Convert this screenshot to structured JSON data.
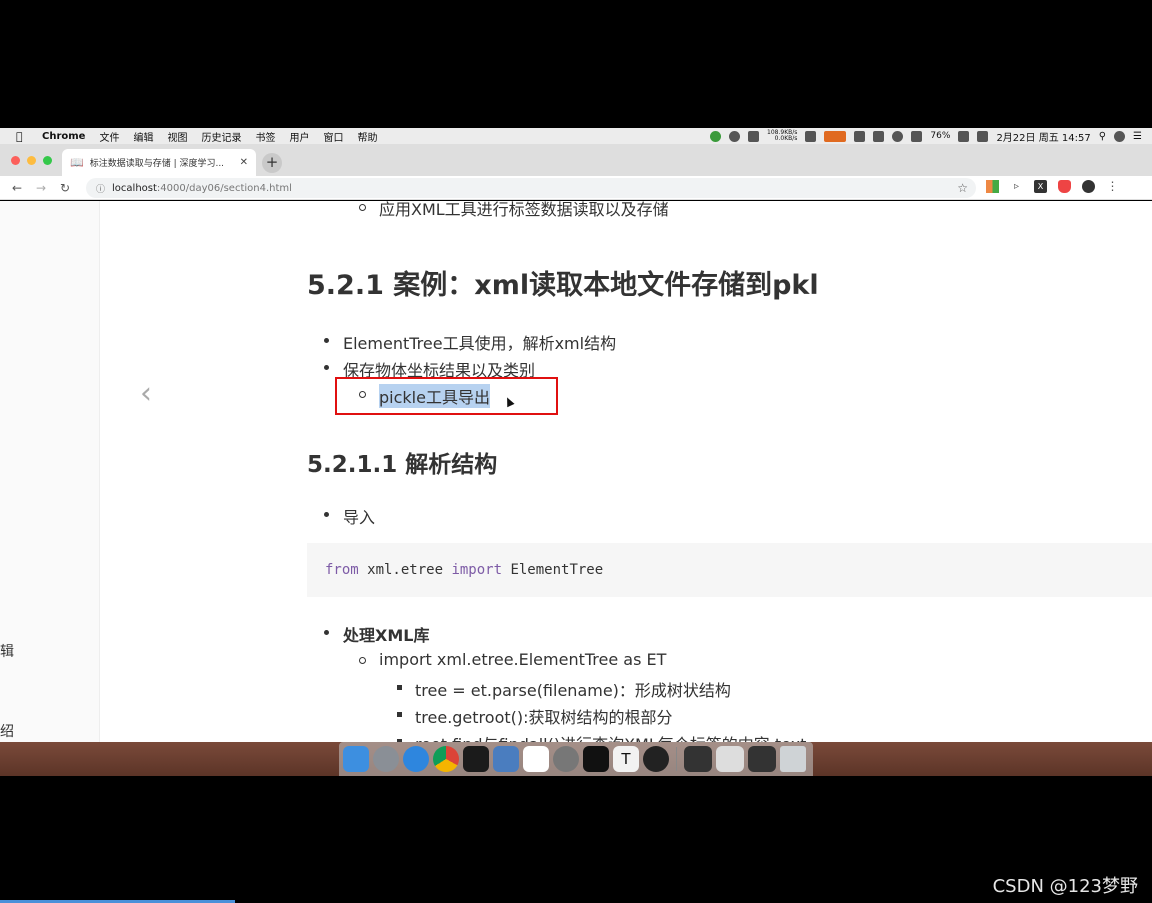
{
  "menubar": {
    "app": "Chrome",
    "items": [
      "文件",
      "编辑",
      "视图",
      "历史记录",
      "书签",
      "用户",
      "窗口",
      "帮助"
    ],
    "net_up": "108.9KB/s",
    "net_down": "0.0KB/s",
    "battery": "76%",
    "datetime": "2月22日 周五  14:57"
  },
  "browser": {
    "tab_title": "标注数据读取与存储 | 深度学习...",
    "url_host": "localhost",
    "url_path": ":4000/day06/section4.html"
  },
  "sidebar": {
    "fragments": [
      "辑",
      "绍"
    ]
  },
  "page": {
    "top_item": "应用XML工具进行标签数据读取以及存储",
    "h1": "5.2.1 案例：xml读取本地文件存储到pkl",
    "bullets1": [
      "ElementTree工具使用，解析xml结构",
      "保存物体坐标结果以及类别"
    ],
    "sub_highlight": "pickle工具导出",
    "h2": "5.2.1.1 解析结构",
    "import_bullet": "导入",
    "code": {
      "from": "from",
      "module": " xml.etree ",
      "import": "import",
      "name": " ElementTree"
    },
    "xml_lib": "处理XML库",
    "xml_sub": "import xml.etree.ElementTree as ET",
    "xml_items": [
      "tree = et.parse(filename)：形成树状结构",
      "tree.getroot():获取树结构的根部分",
      "root.find与findall()进行查询XML每个标签的内容.text"
    ]
  },
  "watermark": "CSDN @123梦野",
  "colors": {
    "highlight": "#b7d2f0",
    "annotation_box": "#e01010",
    "code_keyword": "#7d5ba6"
  }
}
